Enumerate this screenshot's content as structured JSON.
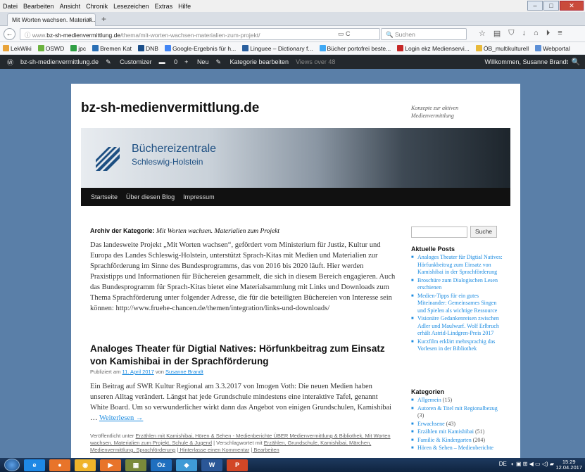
{
  "menubar": {
    "items": [
      "Datei",
      "Bearbeiten",
      "Ansicht",
      "Chronik",
      "Lesezeichen",
      "Extras",
      "Hilfe"
    ]
  },
  "window_controls": {
    "minimize": "–",
    "maximize": "□",
    "close": "✕"
  },
  "tab": {
    "title": "Mit Worten wachsen. Materiali...",
    "close": "×",
    "new_tab": "+"
  },
  "nav": {
    "back": "←",
    "info": "ⓘ",
    "url_plain": "www.",
    "url_host": "bz-sh-medienvermittlung.de",
    "url_path": "/thema/mit-worten-wachsen-materialien-zum-projekt/",
    "url_icons": "▭  C",
    "search_placeholder": "Suchen",
    "search_icon": "🔍",
    "toolbar_icons": [
      "☆",
      "▤",
      "⛉",
      "↓",
      "⌂",
      "⏵",
      "≡"
    ]
  },
  "bookmarks": [
    {
      "label": "LekWiki",
      "color": "#e8a33a"
    },
    {
      "label": "OSWD",
      "color": "#6cb33f"
    },
    {
      "label": "jpc",
      "color": "#2f9e44"
    },
    {
      "label": "Bremen Kat",
      "color": "#2a6fb5"
    },
    {
      "label": "DNB",
      "color": "#1b4f8a"
    },
    {
      "label": "Google-Ergebnis für h...",
      "color": "#4285f4"
    },
    {
      "label": "Linguee – Dictionary f...",
      "color": "#2a5f9e"
    },
    {
      "label": "Bücher portofrei beste...",
      "color": "#3fa9f5"
    },
    {
      "label": "Login ekz Medienservi...",
      "color": "#c62828"
    },
    {
      "label": "ÖB_multikulturell",
      "color": "#e8b93a"
    },
    {
      "label": "Webportal",
      "color": "#5c8fd6"
    }
  ],
  "wpbar": {
    "wp_logo": "Ⓦ",
    "site": "bz-sh-medienvermittlung.de",
    "customizer": "Customizer",
    "comments": "0",
    "new": "Neu",
    "edit": "Kategorie bearbeiten",
    "views": "Views over 48",
    "welcome": "Willkommen, Susanne Brandt",
    "search_icon": "🔍"
  },
  "site": {
    "title": "bz-sh-medienvermittlung.de",
    "description": "Konzepte zur aktiven Medienvermittlung",
    "banner_line1": "Büchereizentrale",
    "banner_line2": "Schleswig-Holstein"
  },
  "pagenav": [
    "Startseite",
    "Über diesen Blog",
    "Impressum"
  ],
  "archive": {
    "label": "Archiv der Kategorie:",
    "name": "Mit Worten wachsen. Materialien zum Projekt"
  },
  "intro": "Das landesweite Projekt „Mit Worten wachsen“, gefördert vom Ministerium für Justiz, Kultur und Europa des Landes Schleswig-Holstein, unterstützt Sprach-Kitas mit Medien und Materialien zur Sprachförderung im Sinne des Bundesprogramms, das von 2016 bis 2020 läuft. Hier werden Praxistipps und Informationen für Büchereien gesammelt, die sich in diesem Bereich engagieren. Auch das Bundesprogramm für Sprach-Kitas bietet eine Materialsammlung mit Links und Downloads zum Thema Sprachförderung unter folgender Adresse, die für die beteiligten Büchereien von Interesse sein können: http://www.fruehe-chancen.de/themen/integration/links-und-downloads/",
  "post": {
    "title": "Analoges Theater für Digtial Natives: Hörfunkbeitrag zum Einsatz von Kamishibai in der Sprachförderung",
    "meta_prefix": "Publiziert am",
    "date": "11. April 2017",
    "meta_mid": "von",
    "author": "Susanne Brandt",
    "excerpt": "Ein Beitrag auf SWR Kultur Regional am 3.3.2017 von Imogen Voth: Die neuen Medien haben unseren Alltag verändert. Längst hat jede Grundschule mindestens eine interaktive Tafel, genannt White Board. Um so verwunderlicher wirkt dann das Angebot von einigen Grundschulen, Kamishibai …",
    "read_more": "Weiterlesen →",
    "footer_prefix": "Veröffentlicht unter",
    "categories": "Erzählen mit Kamishibai, Hören & Sehen - Medienberichte ÜBER Medienvermittlung & Bibliothek, Mit Worten wachsen. Materialien zum Projekt, Schule & Jugend",
    "footer_mid": "| Verschlagwortet mit",
    "tags": "Erzählen, Grundschule, Kamishibai, Märchen, Medienvermittlung, Sprachförderung",
    "footer_comment": "| Hinterlasse einen Kommentar",
    "footer_edit": "| Bearbeiten"
  },
  "sidebar": {
    "search_button": "Suche",
    "recent_heading": "Aktuelle Posts",
    "recent_posts": [
      "Analoges Theater für Digtial Natives: Hörfunkbeitrag zum Einsatz von Kamishibai in der Sprachförderung",
      "Broschüre zum Dialogischen Lesen erschienen",
      "Medien-Tipps für ein gutes Miteinander: Gemeinsames Singen und Spielen als wichtige Ressource",
      "Visionäre Gedankenreisen zwischen Adler und Maulwurf. Wolf Erlbruch erhält Astrid-Lindgren-Preis 2017",
      "Kurzfilm erklärt mehrsprachig das Vorlesen in der Bibliothek"
    ],
    "categories_heading": "Kategorien",
    "categories": [
      {
        "name": "Allgemein",
        "count": "(15)"
      },
      {
        "name": "Autoren & Titel mit Regionalbezug",
        "count": "(3)"
      },
      {
        "name": "Erwachsene",
        "count": "(43)"
      },
      {
        "name": "Erzählen mit Kamishibai",
        "count": "(51)"
      },
      {
        "name": "Familie & Kindergarten",
        "count": "(204)"
      },
      {
        "name": "Hören & Sehen – Medienberichte",
        "count": ""
      }
    ]
  },
  "taskbar": {
    "apps": [
      {
        "label": "e",
        "color": "#1e88e5"
      },
      {
        "label": "●",
        "color": "#e8742a"
      },
      {
        "label": "◉",
        "color": "#f0b42a"
      },
      {
        "label": "▶",
        "color": "#e8742a"
      },
      {
        "label": "▦",
        "color": "#7b8a3a"
      },
      {
        "label": "Oz",
        "color": "#1f6fbf"
      },
      {
        "label": "◆",
        "color": "#3f9bd6"
      },
      {
        "label": "W",
        "color": "#2b5797"
      },
      {
        "label": "P",
        "color": "#d24726"
      }
    ],
    "tray_lang": "DE",
    "tray_icons": "◐ ▣ ⊞ ◀ ▭ ◁) ▰",
    "time": "15:29",
    "date": "12.04.2017"
  }
}
